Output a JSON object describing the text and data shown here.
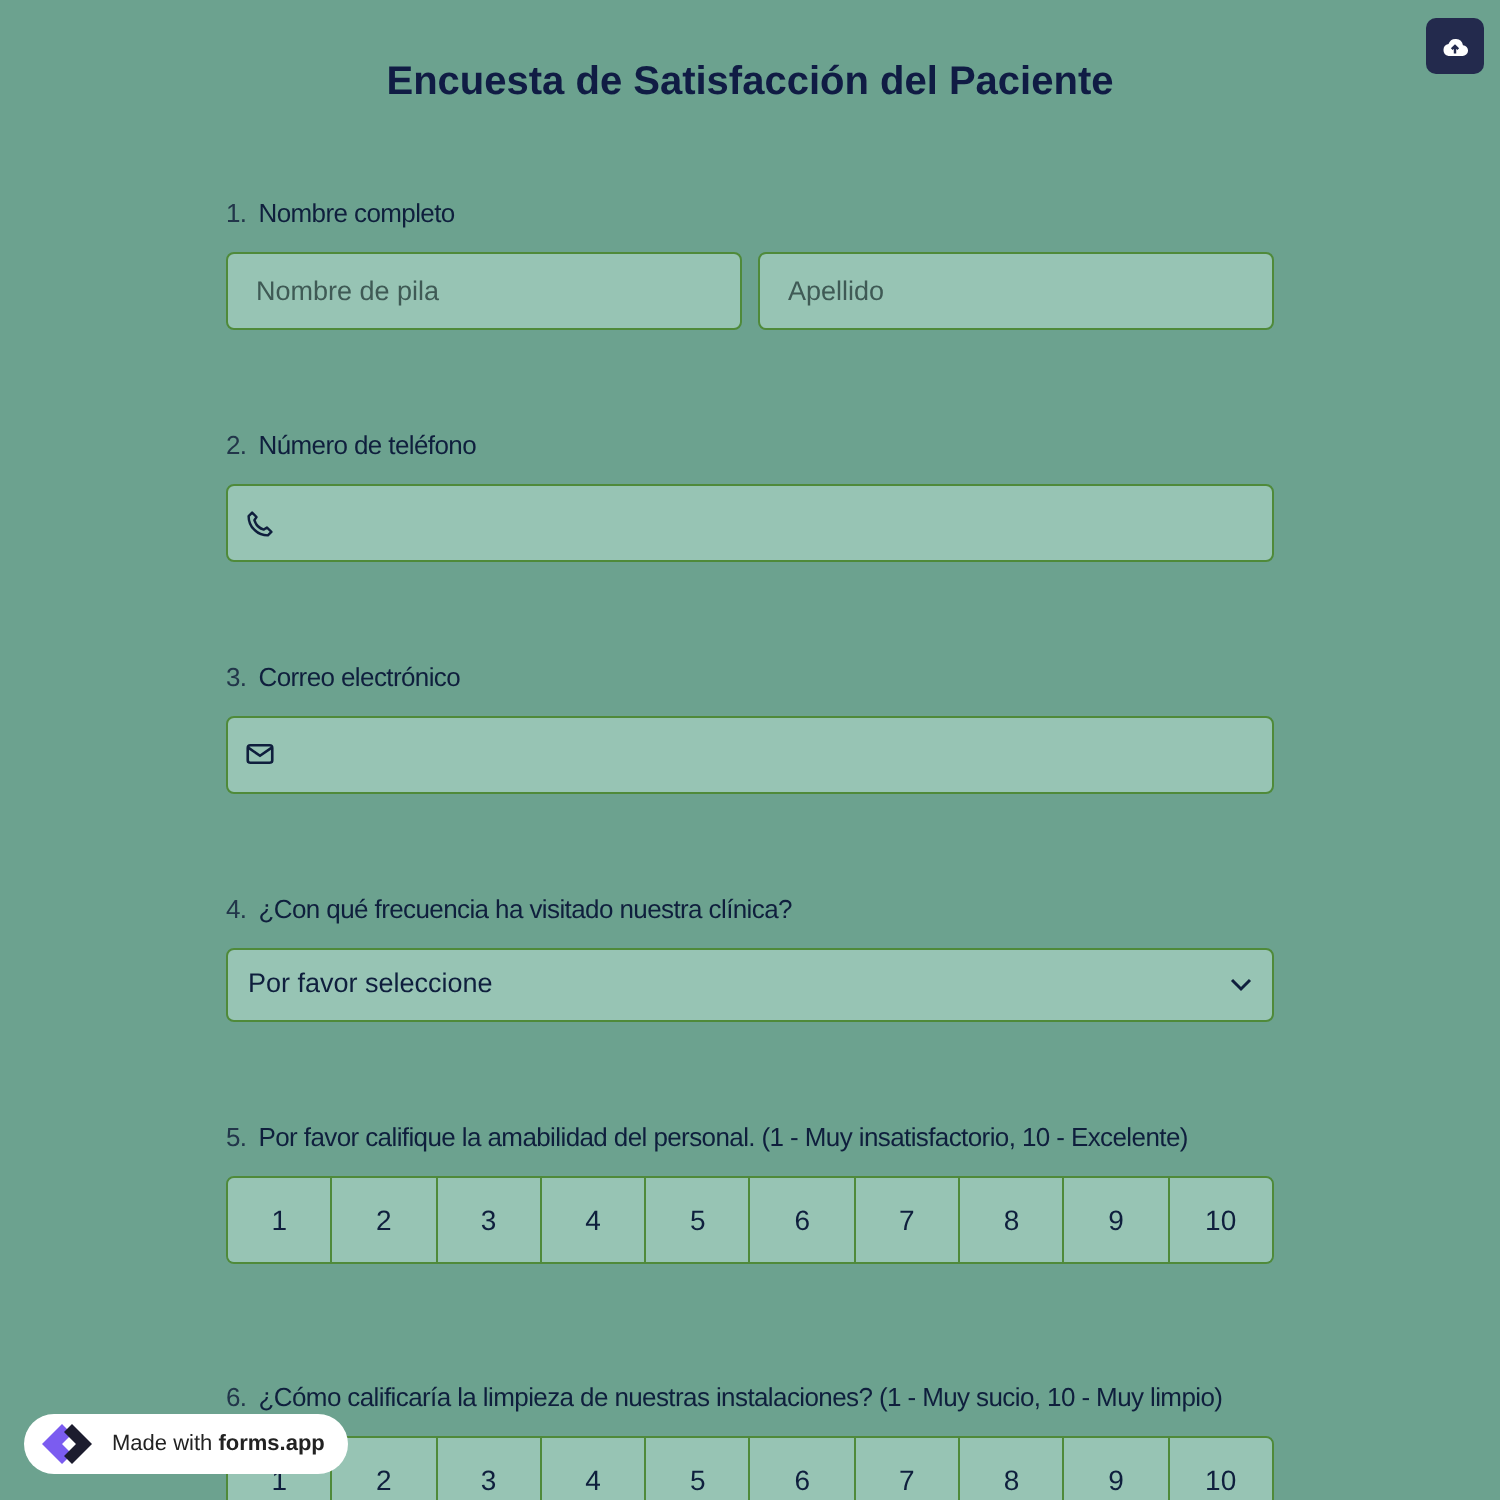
{
  "title": "Encuesta de Satisfacción del Paciente",
  "questions": [
    {
      "number": "1.",
      "label": "Nombre completo",
      "kind": "name",
      "fields": [
        {
          "placeholder": "Nombre de pila"
        },
        {
          "placeholder": "Apellido"
        }
      ]
    },
    {
      "number": "2.",
      "label": "Número de teléfono",
      "kind": "phone"
    },
    {
      "number": "3.",
      "label": "Correo electrónico",
      "kind": "email"
    },
    {
      "number": "4.",
      "label": "¿Con qué frecuencia ha visitado nuestra clínica?",
      "kind": "select",
      "value": "Por favor seleccione"
    },
    {
      "number": "5.",
      "label": "Por favor califique la amabilidad del personal. (1 - Muy insatisfactorio, 10 - Excelente)",
      "kind": "scale",
      "options": [
        "1",
        "2",
        "3",
        "4",
        "5",
        "6",
        "7",
        "8",
        "9",
        "10"
      ]
    },
    {
      "number": "6.",
      "label": "¿Cómo calificaría la limpieza de nuestras instalaciones? (1 - Muy sucio, 10 - Muy limpio)",
      "kind": "scale",
      "options": [
        "1",
        "2",
        "3",
        "4",
        "5",
        "6",
        "7",
        "8",
        "9",
        "10"
      ]
    }
  ],
  "badge": "Made with **forms.app**"
}
